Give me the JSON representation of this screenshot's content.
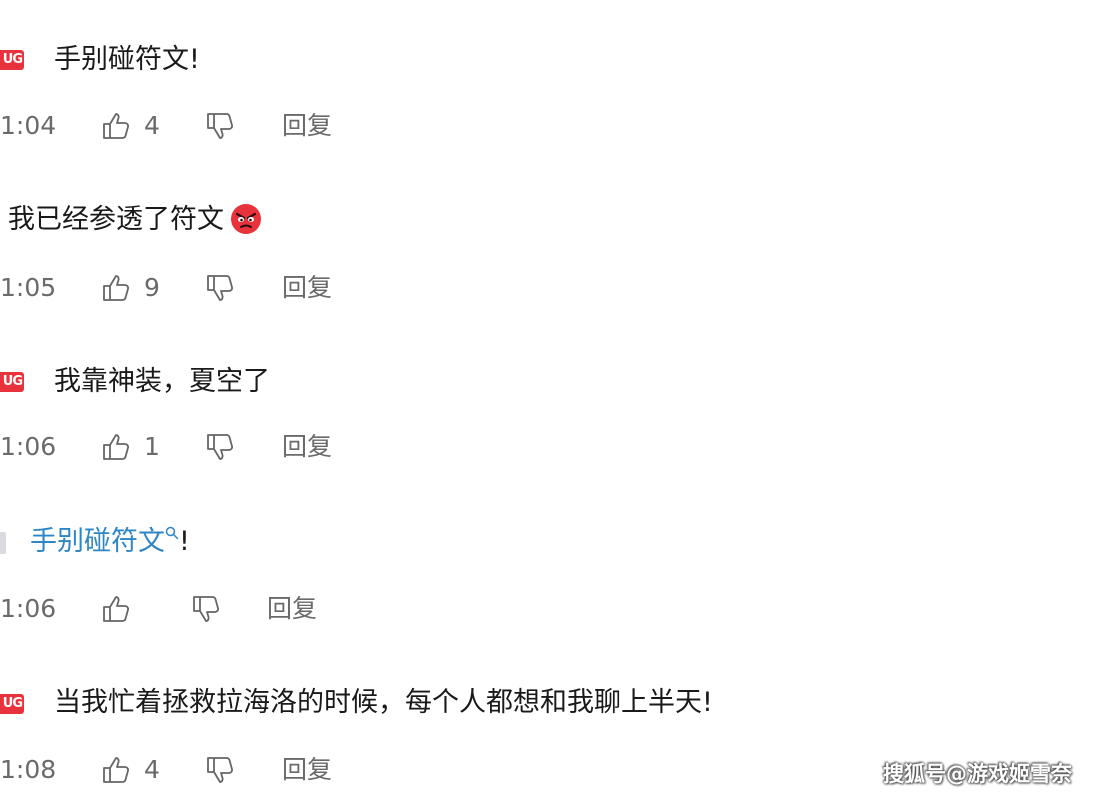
{
  "comments": [
    {
      "badge": "UG",
      "text": "手别碰符文!",
      "time": "1:04",
      "likes": "4",
      "reply_label": "回复"
    },
    {
      "badge": "",
      "text": "我已经参透了符文",
      "emoji": "angry-face-icon",
      "time": "1:05",
      "likes": "9",
      "reply_label": "回复"
    },
    {
      "badge": "UG",
      "text": "我靠神装，夏空了",
      "time": "1:06",
      "likes": "1",
      "reply_label": "回复"
    },
    {
      "badge": "",
      "text_link": "手别碰符文",
      "text_suffix": "!",
      "time": "1:06",
      "likes": "",
      "reply_label": "回复"
    },
    {
      "badge": "UG",
      "text": "当我忙着拯救拉海洛的时候，每个人都想和我聊上半天!",
      "time": "1:08",
      "likes": "4",
      "reply_label": "回复"
    }
  ],
  "watermark": "搜狐号@游戏姬雪奈",
  "colors": {
    "badge": "#e8333c",
    "link": "#2f86c6",
    "meta_text": "#6a6a6a",
    "emoji": "#e8333c"
  }
}
